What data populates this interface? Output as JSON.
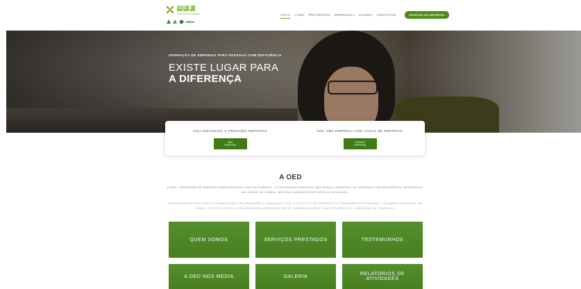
{
  "header": {
    "logo_text": "OED",
    "logo_sub": "OPERAÇÃO DE EMPREGO",
    "logo_lisboa": "LISBOA",
    "nav": [
      {
        "label": "INÍCIO",
        "active": true
      },
      {
        "label": "A OED",
        "active": false
      },
      {
        "label": "PRÉ-REGISTO",
        "active": false
      },
      {
        "label": "EMPRESAS ▾",
        "active": false
      },
      {
        "label": "GALERIA",
        "active": false
      },
      {
        "label": "CONTACTOS",
        "active": false
      }
    ],
    "cta": "OFERTAS DE EMPREGO"
  },
  "hero": {
    "kicker": "OPERAÇÃO DE EMPREGO PARA PESSOAS COM DEFICIÊNCIA",
    "title_line1": "EXISTE LUGAR PARA",
    "title_line2": "A DIFERENÇA"
  },
  "cards": {
    "left_label": "SOU INDIVIDUAL E PROCURO EMPREGO",
    "left_button": "VER OFERTAS",
    "right_label": "SOU UMA EMPRESA COM VAGAS DE EMPREGO",
    "right_button": "ENVIAR OFERTAS"
  },
  "about": {
    "title": "A OED",
    "p1": "A OED - OPERAÇÃO DE EMPREGO PARA PESSOAS COM DEFICIÊNCIA - É UM SERVIÇO GRATUITO QUE APOIA O EMPREGO DE PESSOAS COM DEFICIÊNCIA, RESIDENTES NA CIDADE DE LISBOA, NOS MAIS VARIADOS SETORES DE ATIVIDADE.",
    "p2": "RESULTA DE UM PROTOCOLO ESTABELECIDO EM 1998 ENTRE A FUNDAÇÃO LIGA, O INSTITUTO DO EMPREGO E FORMAÇÃO PROFISSIONAL E A CÂMARA MUNICIPAL DE LISBOA, E DESDE O INÍCIO QUE ASSEGURA A MEDIAÇÃO ENTRE TRABALHADORES COM DEFICIÊNCIA E O MERCADO DE TRABALHO."
  },
  "tiles": [
    "QUEM SOMOS",
    "SERVIÇOS PRESTADOS",
    "TESTEMUNHOS",
    "A OED NOS MEDIA",
    "GALERIA",
    "RELATÓRIOS DE ATIVIDADES"
  ],
  "colors": {
    "brand_green": "#4f8a19",
    "nav_active": "#67a72d",
    "tile_green": "#4e8a24"
  }
}
